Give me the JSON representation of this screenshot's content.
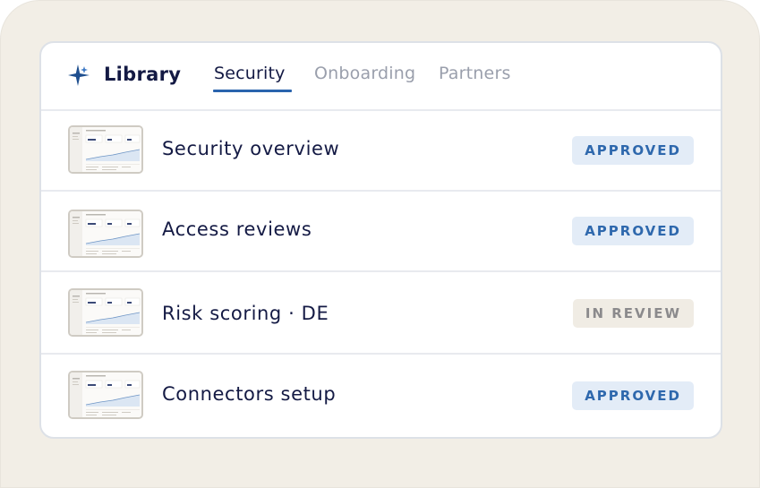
{
  "header": {
    "brand_icon": "sparkle-icon",
    "brand_title": "Library",
    "accent_color": "#2a64ad",
    "tabs": [
      {
        "label": "Security",
        "active": true
      },
      {
        "label": "Onboarding",
        "active": false
      },
      {
        "label": "Partners",
        "active": false
      }
    ]
  },
  "documents": [
    {
      "title": "Security overview",
      "status": "APPROVED",
      "status_kind": "approved"
    },
    {
      "title": "Access reviews",
      "status": "APPROVED",
      "status_kind": "approved"
    },
    {
      "title": "Risk scoring · DE",
      "status": "IN REVIEW",
      "status_kind": "review"
    },
    {
      "title": "Connectors setup",
      "status": "APPROVED",
      "status_kind": "approved"
    }
  ],
  "colors": {
    "approved_bg": "#e3ecf7",
    "approved_text": "#2e68ad",
    "review_bg": "#f0ece4",
    "review_text": "#8b8a8c"
  }
}
